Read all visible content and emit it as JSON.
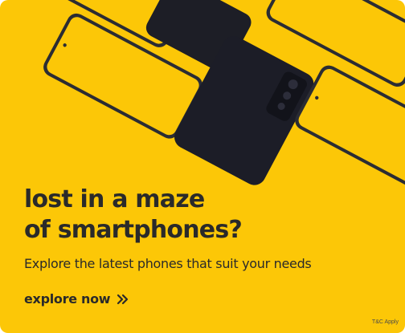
{
  "banner": {
    "headline_line1": "lost in a maze",
    "headline_line2": "of smartphones?",
    "subtitle": "Explore the latest phones that suit your needs",
    "cta_label": "explore now",
    "cta_icon": "double-chevron-right-icon",
    "terms": "T&C Apply"
  },
  "colors": {
    "background": "#fcc707",
    "text": "#2a2a2a",
    "phone_frame": "#22232b",
    "phone_screen": "#fcc707"
  }
}
